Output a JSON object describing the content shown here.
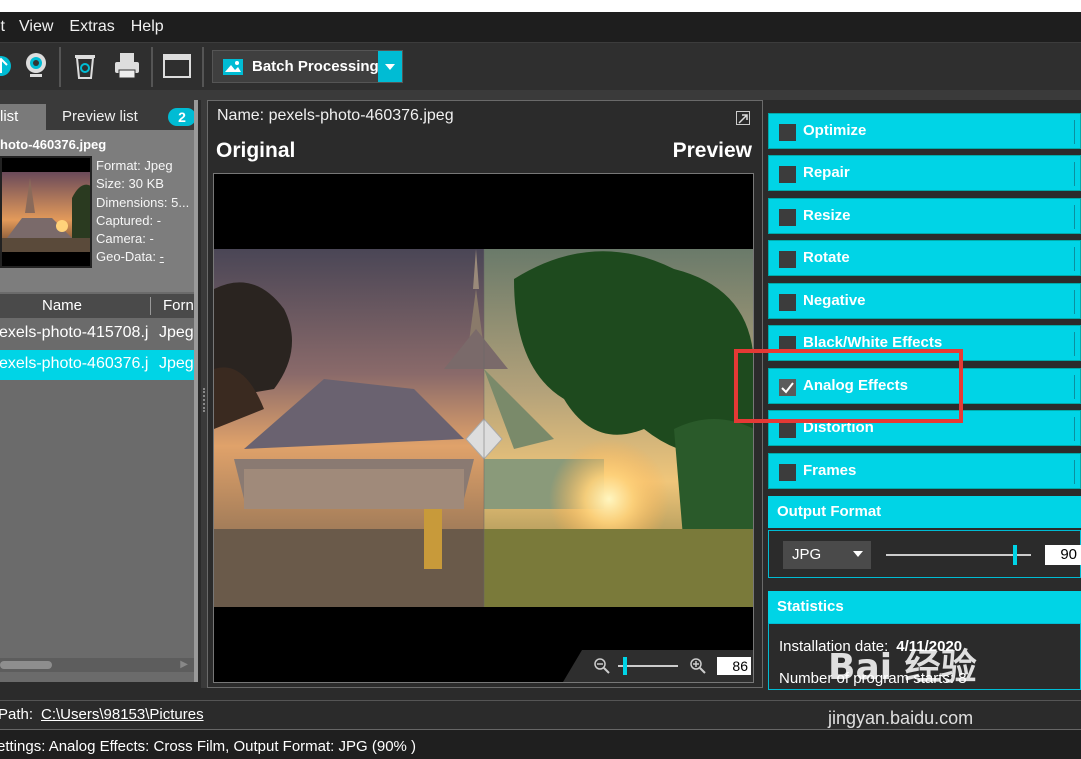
{
  "menu": {
    "edit": "it",
    "view": "View",
    "extras": "Extras",
    "help": "Help"
  },
  "toolbar": {
    "batch_label": "Batch Processing"
  },
  "left": {
    "tab_list": "list",
    "tab_preview": "Preview list",
    "badge": "2",
    "file_name": "hoto-460376.jpeg",
    "format": "Format: Jpeg",
    "size": "Size: 30 KB",
    "dimensions": "Dimensions: 5...",
    "captured": "Captured: -",
    "camera": "Camera: -",
    "geo_label": "Geo-Data:",
    "geo_value": "-",
    "col_name": "Name",
    "col_format": "Forn",
    "rows": [
      {
        "name": "exels-photo-415708.j",
        "format": "Jpeg"
      },
      {
        "name": "exels-photo-460376.j",
        "format": "Jpeg"
      }
    ]
  },
  "center": {
    "name_label": "Name: pexels-photo-460376.jpeg",
    "original": "Original",
    "preview": "Preview",
    "zoom": "86",
    "zoom_unit": "%"
  },
  "right": {
    "items": [
      {
        "label": "Optimize",
        "checked": false
      },
      {
        "label": "Repair",
        "checked": false
      },
      {
        "label": "Resize",
        "checked": false
      },
      {
        "label": "Rotate",
        "checked": false
      },
      {
        "label": "Negative",
        "checked": false
      },
      {
        "label": "Black/White Effects",
        "checked": false
      },
      {
        "label": "Analog Effects",
        "checked": true
      },
      {
        "label": "Distortion",
        "checked": false
      },
      {
        "label": "Frames",
        "checked": false
      }
    ],
    "output_format_title": "Output Format",
    "format_value": "JPG",
    "quality": "90",
    "quality_fraction": 0.9,
    "statistics_title": "Statistics",
    "install_label": "Installation date:",
    "install_value": "4/11/2020",
    "program_starts": "Number of program starts: 8"
  },
  "bottom": {
    "path_label": "Path:",
    "path_value": "C:\\Users\\98153\\Pictures",
    "settings": "ettings: Analog Effects: Cross Film, Output Format: JPG (90% )"
  },
  "watermark": {
    "brand": "Bai 经验",
    "url": "jingyan.baidu.com"
  },
  "colors": {
    "accent": "#00d4e6",
    "highlight": "#e53935",
    "background": "#2b2b2b"
  }
}
